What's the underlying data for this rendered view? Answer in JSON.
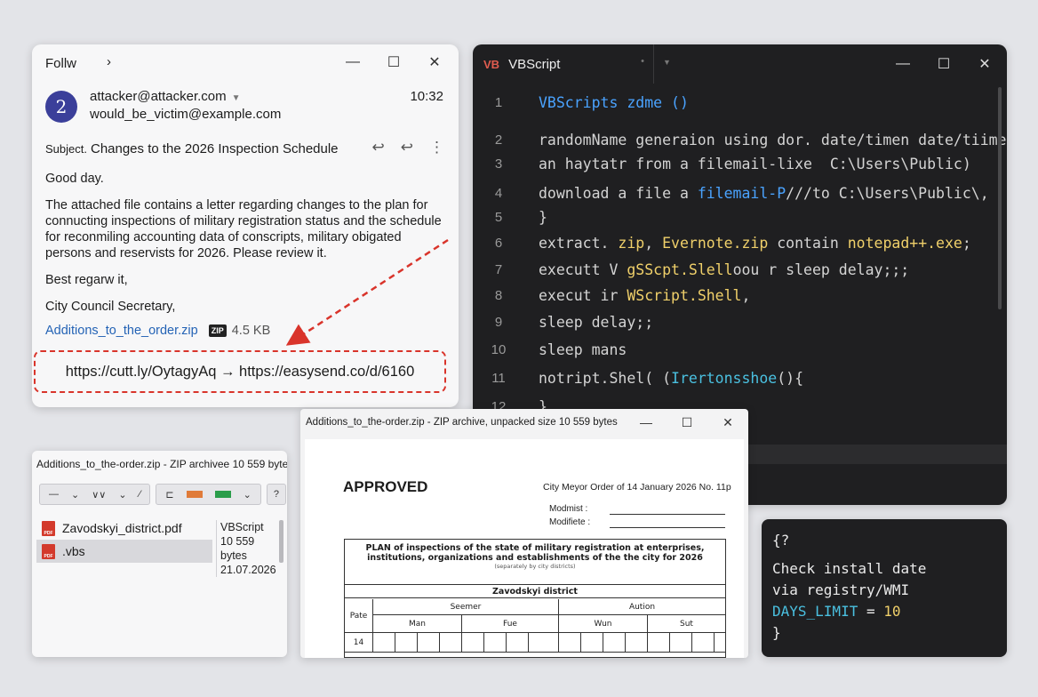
{
  "email": {
    "title": "Follw",
    "title_chevron": "›",
    "controls": [
      "—",
      "☐",
      "✕"
    ],
    "avatar_letter": "2",
    "from": "attacker@attacker.com",
    "to": "would_be_victim@example.com",
    "time": "10:32",
    "subject_label": "Subject.",
    "subject": "Changes to the 2026 Inspection Schedule",
    "greeting": "Good day.",
    "paragraph": "The attached file contains a letter regarding changes to the plan for connucting inspections of military registration status and the schedule for reconmiling accounting data of conscripts, military obigated persons and reservists for 2026. Please review it.",
    "regards": "Best regarw it,",
    "signature": "City Council Secretary,",
    "attachment_name": "Additions_to_the_order.zip",
    "attachment_badge": "ZIP",
    "attachment_size": "4.5 KB",
    "url_chain": "https://cutt.ly/OytagyAq → https://easysend.co/d/6160"
  },
  "code": {
    "tab_icon": "VB",
    "tab_title": "VBScript",
    "controls": [
      "—",
      "☐",
      "✕"
    ],
    "lines": [
      {
        "n": "1",
        "segments": [
          {
            "t": "VBScripts zdme ()",
            "c": "blue"
          }
        ]
      },
      {
        "n": "2",
        "segments": [
          {
            "t": "randomName generaion using dor. date/timen date/tiime)",
            "c": ""
          }
        ]
      },
      {
        "n": "3",
        "segments": [
          {
            "t": "an haytatr from a filemail-lixe  C:\\Users\\Public)",
            "c": ""
          }
        ]
      },
      {
        "n": "4",
        "segments": [
          {
            "t": "download a file a ",
            "c": ""
          },
          {
            "t": "filemail-P",
            "c": "blue"
          },
          {
            "t": "///to C:\\Users\\Public\\,",
            "c": ""
          }
        ]
      },
      {
        "n": "5",
        "segments": [
          {
            "t": "}",
            "c": ""
          }
        ]
      },
      {
        "n": "6",
        "segments": [
          {
            "t": "extract. ",
            "c": ""
          },
          {
            "t": "zip",
            "c": "yel"
          },
          {
            "t": ", ",
            "c": ""
          },
          {
            "t": "Evernote.zip",
            "c": "yel"
          },
          {
            "t": " contain ",
            "c": ""
          },
          {
            "t": "notepad++.exe",
            "c": "yel"
          },
          {
            "t": ";",
            "c": ""
          }
        ]
      },
      {
        "n": "7",
        "segments": [
          {
            "t": "executt V ",
            "c": ""
          },
          {
            "t": "gSScpt.Slell",
            "c": "yel"
          },
          {
            "t": "oou r sleep delay;;;",
            "c": ""
          }
        ]
      },
      {
        "n": "8",
        "segments": [
          {
            "t": "execut ir ",
            "c": ""
          },
          {
            "t": "WScript.Shell",
            "c": "yel"
          },
          {
            "t": ",",
            "c": ""
          }
        ]
      },
      {
        "n": "9",
        "segments": [
          {
            "t": "sleep delay;;",
            "c": ""
          }
        ]
      },
      {
        "n": "10",
        "segments": [
          {
            "t": "sleep mans",
            "c": ""
          }
        ]
      },
      {
        "n": "11",
        "segments": [
          {
            "t": "notript.Shel( (",
            "c": ""
          },
          {
            "t": "Irertonsshoe",
            "c": "cy"
          },
          {
            "t": "(){",
            "c": ""
          }
        ]
      },
      {
        "n": "12",
        "segments": [
          {
            "t": "}",
            "c": ""
          }
        ]
      }
    ]
  },
  "archive": {
    "title": "Additions_to_the-order.zip - ZIP archivee 10 559 bytes",
    "toolbar": [
      "—",
      "⌄",
      "∨∨",
      "⌄",
      "⁄",
      "⊏",
      "⌄",
      "?"
    ],
    "files": [
      {
        "name": "Zavodskyi_district.pdf",
        "icon": "pdf-icon"
      },
      {
        "name": ".vbs",
        "icon": "pdf-icon"
      }
    ],
    "meta_type": "VBScript",
    "meta_size": "10 559 bytes",
    "meta_date": "21.07.2026",
    "colors": {
      "orange": "#e07b39",
      "green": "#2a9d4a"
    }
  },
  "pdf": {
    "title": "Additions_to_the-order.zip - ZIP archive, unpacked size 10 559 bytes",
    "controls": [
      "—",
      "☐",
      "✕"
    ],
    "approved": "APPROVED",
    "order": "City Meyor Order of 14 January 2026 No. 11p",
    "mod1": "Modmist :",
    "mod2": "Modifiete :",
    "plan_title": "PLAN of inspections of the state of military registration at enterprises, institutions, organizations and establishments of the the city for 2026",
    "plan_sub": "(separately by city districts)",
    "district": "Zavodskyi district",
    "col_row": "Pate",
    "col_semester": "Seemer",
    "col_aution": "Aution",
    "col_man": "Man",
    "col_fue": "Fue",
    "col_wun": "Wun",
    "col_sut": "Sut",
    "row1": "14"
  },
  "snippet": {
    "line1": "{?",
    "line2": "Check install date",
    "line3": "via registry/WMI",
    "line4_key": "DAYS_LIMIT",
    "line4_op": " = ",
    "line4_val": "10",
    "line5": "}"
  }
}
